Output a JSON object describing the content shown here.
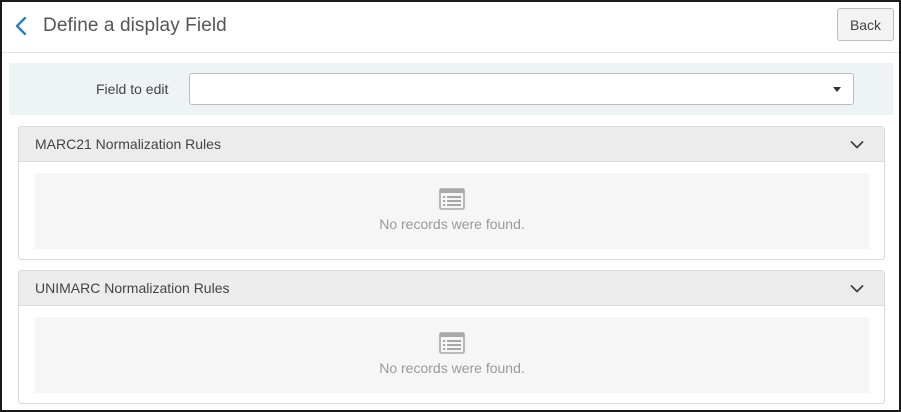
{
  "header": {
    "title": "Define a display Field",
    "back_button_label": "Back",
    "back_icon": "chevron-left-icon"
  },
  "field_to_edit": {
    "label": "Field to edit",
    "value": ""
  },
  "panels": [
    {
      "title": "MARC21 Normalization Rules",
      "empty_message": "No records were found.",
      "icon": "list-icon",
      "toggle_icon": "chevron-down-icon"
    },
    {
      "title": "UNIMARC Normalization Rules",
      "empty_message": "No records were found.",
      "icon": "list-icon",
      "toggle_icon": "chevron-down-icon"
    }
  ],
  "colors": {
    "accent": "#2f7fb8",
    "header_bg": "#ececec",
    "filter_bg": "#eef3f5",
    "empty_bg": "#f6f6f6",
    "muted_text": "#9a9a9a"
  }
}
